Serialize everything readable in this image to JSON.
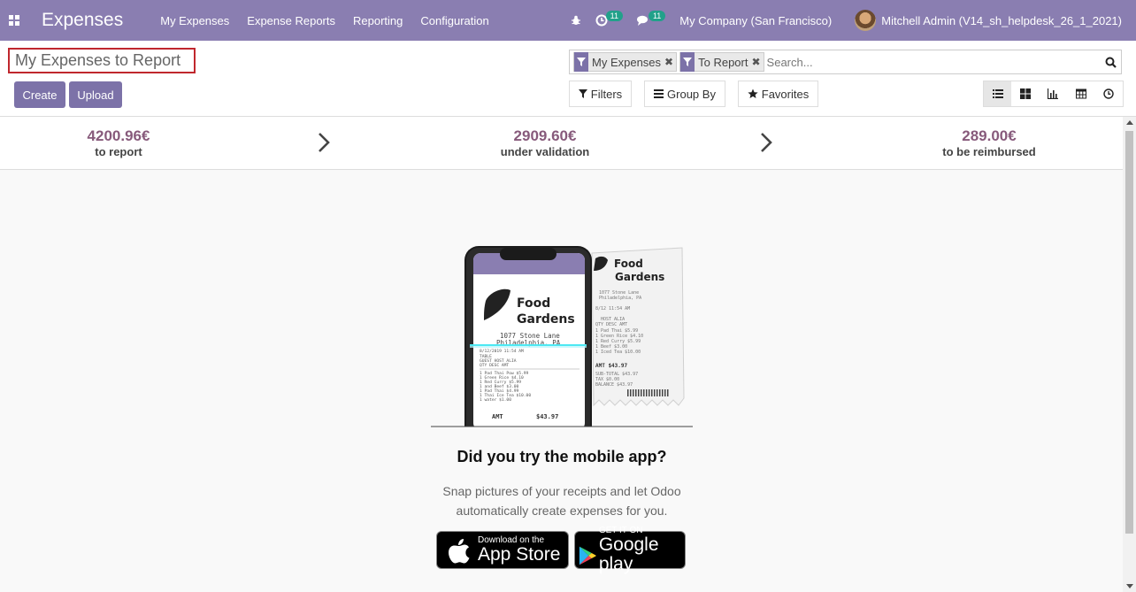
{
  "navbar": {
    "app_title": "Expenses",
    "menu": [
      "My Expenses",
      "Expense Reports",
      "Reporting",
      "Configuration"
    ],
    "activity_count": "11",
    "message_count": "11",
    "company": "My Company (San Francisco)",
    "user": "Mitchell Admin (V14_sh_helpdesk_26_1_2021)"
  },
  "control": {
    "breadcrumb": "My Expenses to Report",
    "create_label": "Create",
    "upload_label": "Upload",
    "facets": [
      "My Expenses",
      "To Report"
    ],
    "search_placeholder": "Search...",
    "filters_label": "Filters",
    "groupby_label": "Group By",
    "favorites_label": "Favorites"
  },
  "dashboard": {
    "to_report_amount": "4200.96€",
    "to_report_label": "to report",
    "under_validation_amount": "2909.60€",
    "under_validation_label": "under validation",
    "reimbursed_amount": "289.00€",
    "reimbursed_label": "to be reimbursed"
  },
  "help": {
    "receipt_title_1": "Food",
    "receipt_title_2": "Gardens",
    "receipt_address_1": "1077 Stone Lane",
    "receipt_address_2": "Philadelphia, PA",
    "receipt_total_label": "AMT",
    "receipt_total": "$43.97",
    "title": "Did you try the mobile app?",
    "text_line1": "Snap pictures of your receipts and let Odoo",
    "text_line2": "automatically create expenses for you.",
    "appstore_small": "Download on the",
    "appstore_big": "App Store",
    "googleplay_small": "GET IT ON",
    "googleplay_big": "Google play"
  },
  "colors": {
    "navbar": "#8a7eb1",
    "primary": "#7c72a8",
    "amount": "#875a7b",
    "badge": "#21a18a"
  }
}
